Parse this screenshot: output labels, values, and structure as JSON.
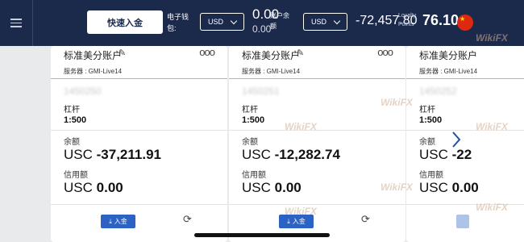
{
  "topbar": {
    "quick_deposit_label": "快速入金",
    "ewallet_label": "电子钱包:",
    "wallet_currency": "USD",
    "wallet_value_primary": "0.00",
    "wallet_value_secondary": "0.00",
    "account_balance_label": "账户余额",
    "balance_currency": "USD",
    "balance_value": "-72,457.80",
    "loyalty_label": "Loyalty Points",
    "loyalty_value": "76.10",
    "flag_icon": "china-flag-icon"
  },
  "cards": [
    {
      "title": "标准美分账户",
      "server": "服务器 : GMI-Live14",
      "account_number": "1450250",
      "leverage_label": "杠杆",
      "leverage_value": "1:500",
      "balance_label": "余额",
      "balance_currency": "USC",
      "balance_value": "-37,211.91",
      "credit_label": "信用额",
      "credit_currency": "USC",
      "credit_value": "0.00",
      "deposit_label": "入金"
    },
    {
      "title": "标准美分账户",
      "server": "服务器 : GMI-Live14",
      "account_number": "1450251",
      "leverage_label": "杠杆",
      "leverage_value": "1:500",
      "balance_label": "余额",
      "balance_currency": "USC",
      "balance_value": "-12,282.74",
      "credit_label": "信用额",
      "credit_currency": "USC",
      "credit_value": "0.00",
      "deposit_label": "入金"
    },
    {
      "title": "标准美分账户",
      "server": "服务器 : GMI-Live14",
      "account_number": "1450252",
      "leverage_label": "杠杆",
      "leverage_value": "1:500",
      "balance_label": "余额",
      "balance_currency": "USC",
      "balance_value": "-22",
      "credit_label": "信用额",
      "credit_currency": "USC",
      "credit_value": "0.00"
    }
  ],
  "watermark": "WikiFX",
  "colors": {
    "topbar_bg": "#1b2a4b",
    "deposit_button": "#2b62c3",
    "page_bg": "#e9eaec"
  }
}
